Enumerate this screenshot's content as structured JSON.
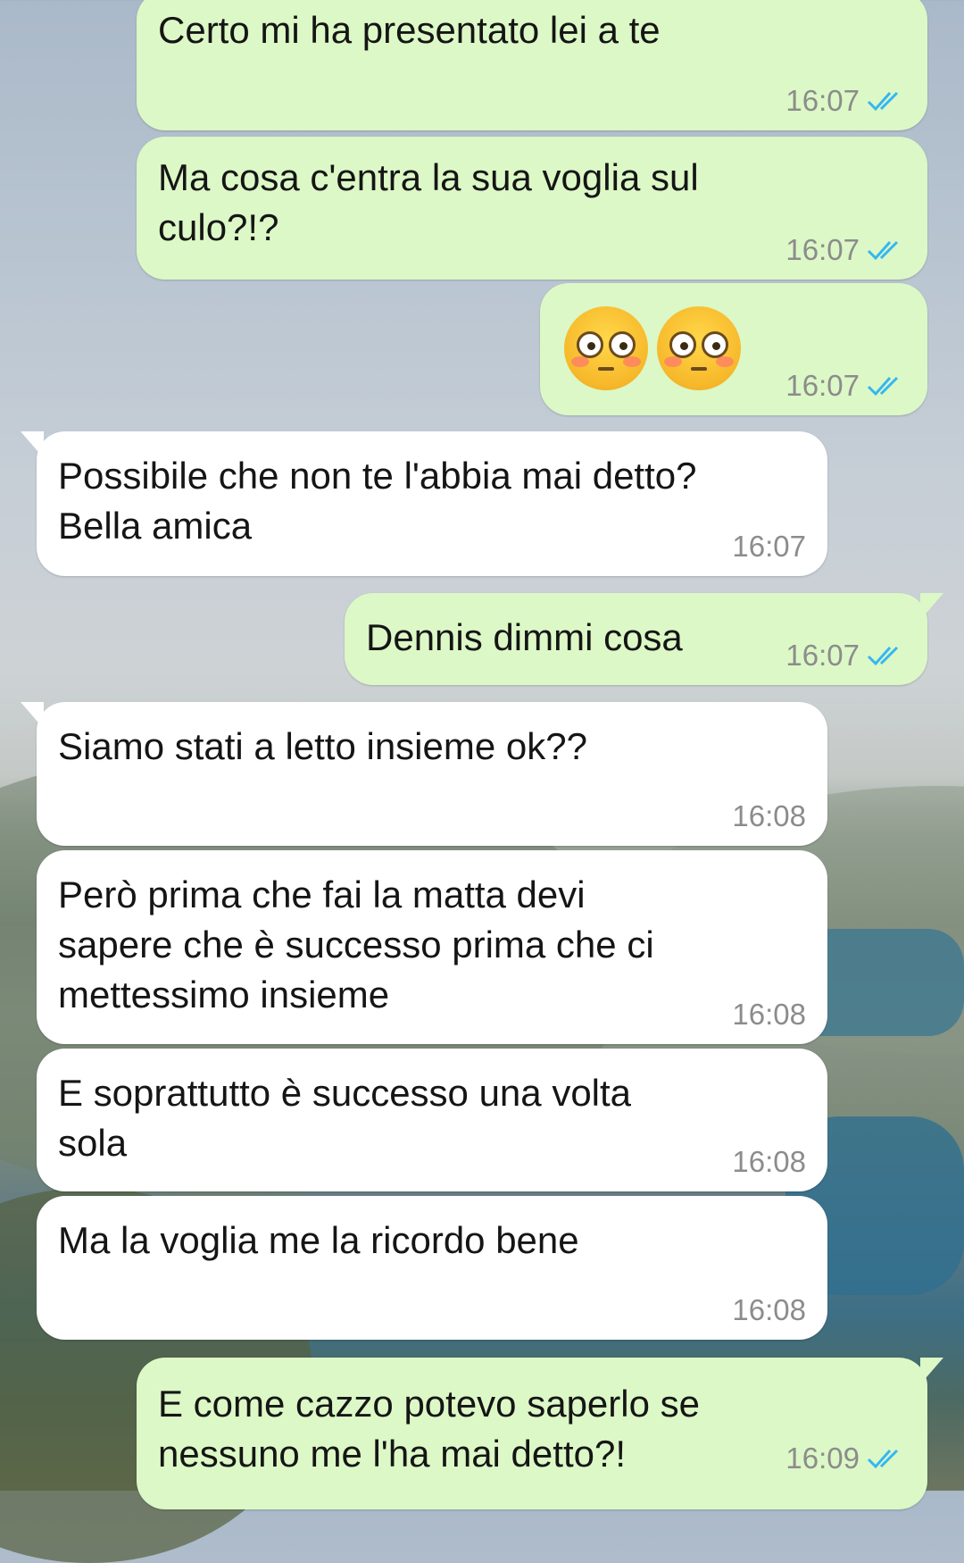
{
  "messages": [
    {
      "dir": "out",
      "text": "Certo mi ha presentato lei a te",
      "time": "16:07",
      "status": "read"
    },
    {
      "dir": "out",
      "text": "Ma cosa c'entra la sua voglia sul\nculo?!?",
      "time": "16:07",
      "status": "read"
    },
    {
      "dir": "out",
      "emoji": "flushed-face flushed-face",
      "time": "16:07",
      "status": "read"
    },
    {
      "dir": "in",
      "text": "Possibile che non te l'abbia mai detto?\nBella amica",
      "time": "16:07"
    },
    {
      "dir": "out",
      "text": "Dennis dimmi cosa",
      "time": "16:07",
      "status": "read"
    },
    {
      "dir": "in",
      "text": "Siamo stati a letto insieme ok??",
      "time": "16:08"
    },
    {
      "dir": "in",
      "text": "Però prima che fai la matta devi\nsapere che è successo prima che ci\nmettessimo insieme",
      "time": "16:08"
    },
    {
      "dir": "in",
      "text": "E soprattutto è successo una volta\nsola",
      "time": "16:08"
    },
    {
      "dir": "in",
      "text": "Ma la voglia me la ricordo bene",
      "time": "16:08"
    },
    {
      "dir": "out",
      "text": "E come cazzo potevo saperlo se\nnessuno me l'ha mai detto?!",
      "time": "16:09",
      "status": "read"
    }
  ],
  "colors": {
    "outgoing_bubble": "#dcf8c6",
    "incoming_bubble": "#ffffff",
    "read_ticks": "#34b7f1",
    "time_text": "#8c8c8c"
  }
}
